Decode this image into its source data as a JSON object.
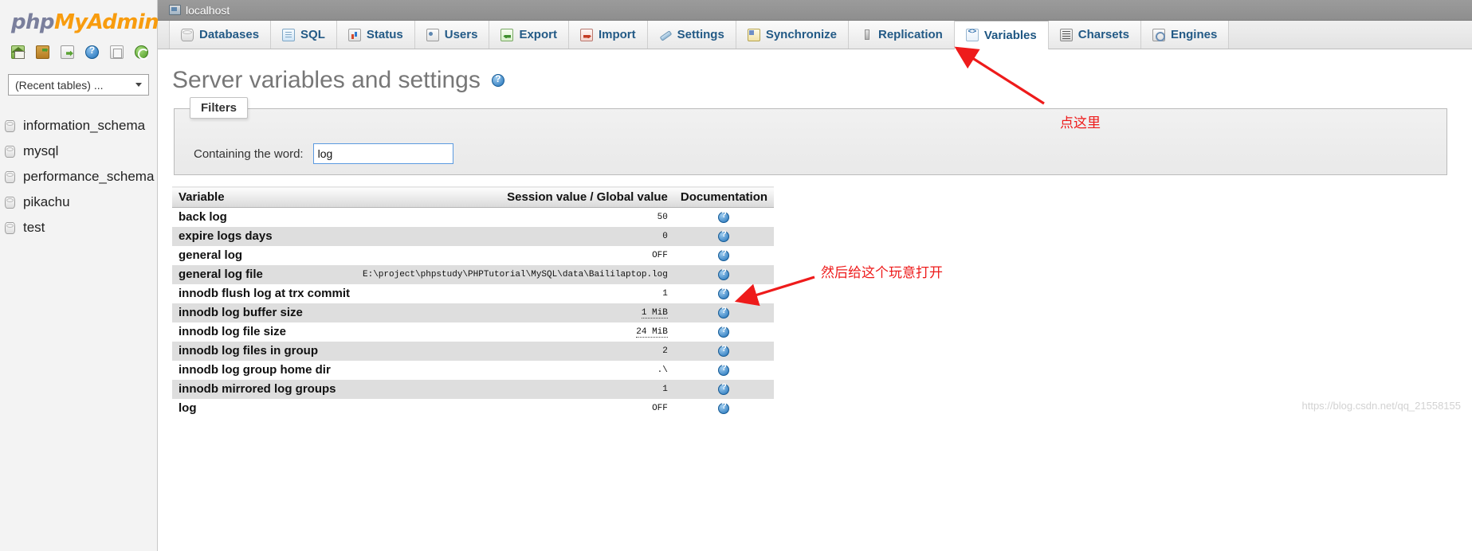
{
  "sidebar": {
    "logo": {
      "part1": "php",
      "part2": "My",
      "part3": "Admin"
    },
    "icons": [
      {
        "name": "home-icon",
        "title": "Home"
      },
      {
        "name": "logout-icon",
        "title": "Log out"
      },
      {
        "name": "export-doc-icon",
        "title": "Export"
      },
      {
        "name": "help-icon",
        "title": "Help"
      },
      {
        "name": "copy-icon",
        "title": "Copy"
      },
      {
        "name": "reload-icon",
        "title": "Reload"
      }
    ],
    "recent_select": {
      "value": "(Recent tables) ..."
    },
    "databases": [
      {
        "name": "information_schema"
      },
      {
        "name": "mysql"
      },
      {
        "name": "performance_schema"
      },
      {
        "name": "pikachu"
      },
      {
        "name": "test"
      }
    ]
  },
  "server": {
    "label": "localhost"
  },
  "tabs": [
    {
      "label": "Databases",
      "icon": "database-icon",
      "active": false
    },
    {
      "label": "SQL",
      "icon": "sql-icon",
      "active": false
    },
    {
      "label": "Status",
      "icon": "status-icon",
      "active": false
    },
    {
      "label": "Users",
      "icon": "users-icon",
      "active": false
    },
    {
      "label": "Export",
      "icon": "export-icon",
      "active": false
    },
    {
      "label": "Import",
      "icon": "import-icon",
      "active": false
    },
    {
      "label": "Settings",
      "icon": "settings-icon",
      "active": false
    },
    {
      "label": "Synchronize",
      "icon": "synchronize-icon",
      "active": false
    },
    {
      "label": "Replication",
      "icon": "replication-icon",
      "active": false
    },
    {
      "label": "Variables",
      "icon": "variables-icon",
      "active": true
    },
    {
      "label": "Charsets",
      "icon": "charsets-icon",
      "active": false
    },
    {
      "label": "Engines",
      "icon": "engines-icon",
      "active": false
    }
  ],
  "page": {
    "title": "Server variables and settings",
    "help_icon": "help-icon"
  },
  "filters": {
    "legend": "Filters",
    "word_label": "Containing the word:",
    "word_value": "log",
    "word_placeholder": ""
  },
  "table": {
    "headers": {
      "variable": "Variable",
      "value": "Session value / Global value",
      "documentation": "Documentation"
    },
    "rows": [
      {
        "variable": "back log",
        "value": "50",
        "linked": false
      },
      {
        "variable": "expire logs days",
        "value": "0",
        "linked": false
      },
      {
        "variable": "general log",
        "value": "OFF",
        "linked": false
      },
      {
        "variable": "general log file",
        "value": "E:\\project\\phpstudy\\PHPTutorial\\MySQL\\data\\Baililaptop.log",
        "linked": false
      },
      {
        "variable": "innodb flush log at trx commit",
        "value": "1",
        "linked": false
      },
      {
        "variable": "innodb log buffer size",
        "value": "1 MiB",
        "linked": true
      },
      {
        "variable": "innodb log file size",
        "value": "24 MiB",
        "linked": true
      },
      {
        "variable": "innodb log files in group",
        "value": "2",
        "linked": false
      },
      {
        "variable": "innodb log group home dir",
        "value": ".\\",
        "linked": false
      },
      {
        "variable": "innodb mirrored log groups",
        "value": "1",
        "linked": false
      },
      {
        "variable": "log",
        "value": "OFF",
        "linked": false
      }
    ]
  },
  "annotations": {
    "accent_color": "#ee1b1b",
    "note1": "点这里",
    "note2": "然后给这个玩意打开"
  },
  "watermark": {
    "text": "https://blog.csdn.net/qq_21558155"
  }
}
